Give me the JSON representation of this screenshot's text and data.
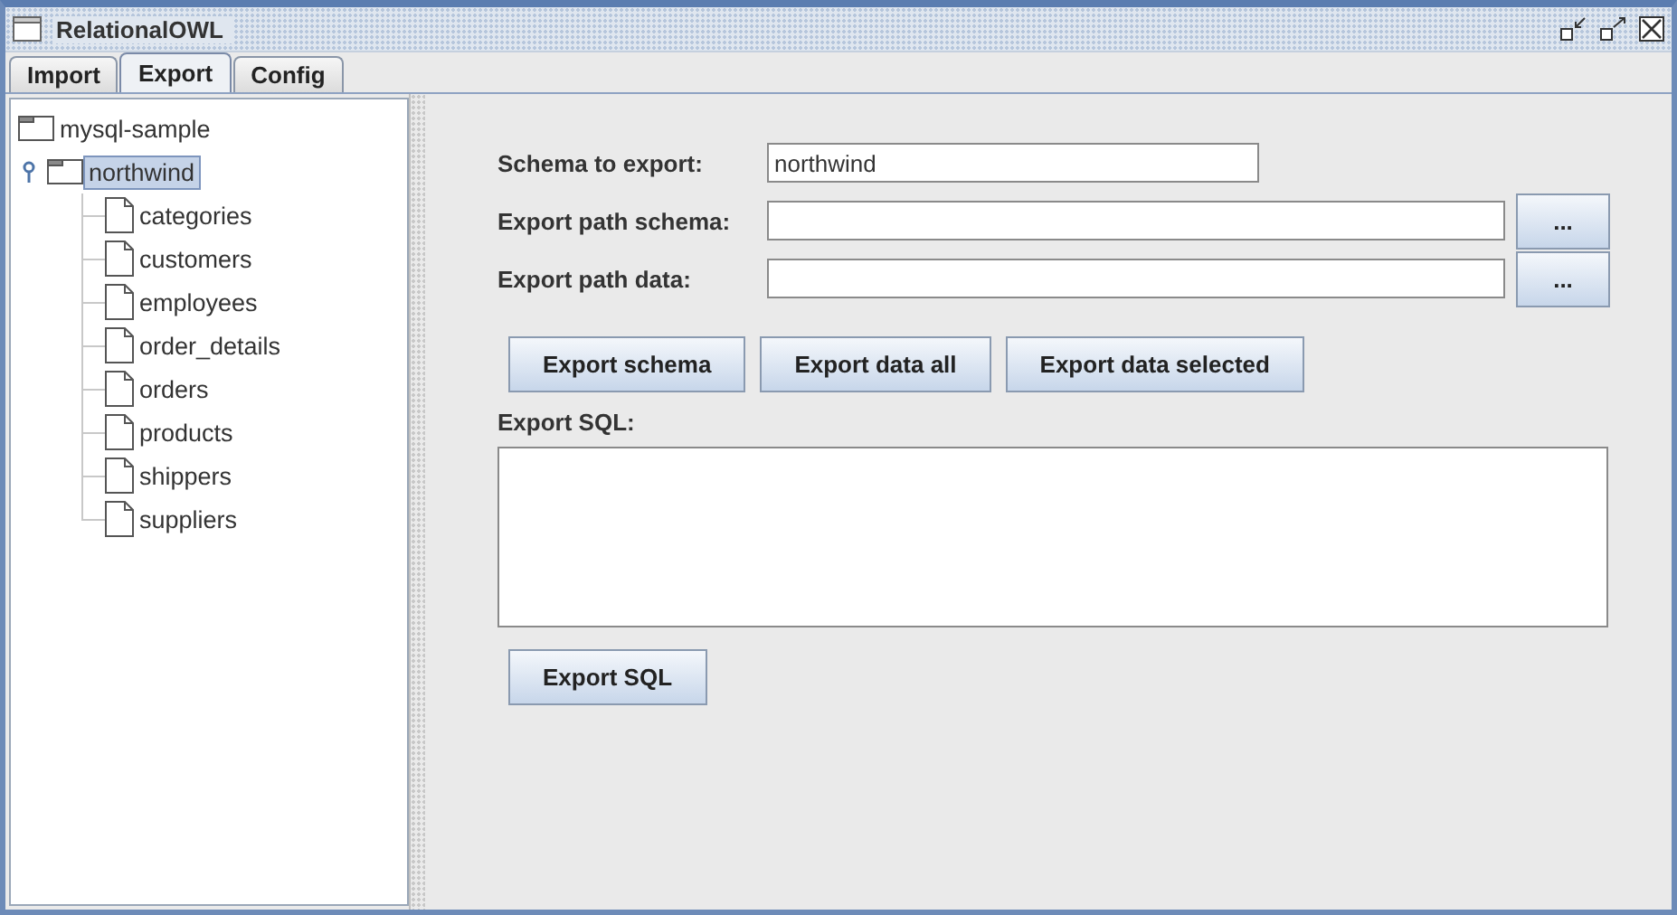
{
  "window": {
    "title": "RelationalOWL"
  },
  "tabs": [
    {
      "label": "Import",
      "selected": false
    },
    {
      "label": "Export",
      "selected": true
    },
    {
      "label": "Config",
      "selected": false
    }
  ],
  "tree": {
    "label": "mysql-sample",
    "kind": "folder",
    "selected": false,
    "children": [
      {
        "label": "northwind",
        "kind": "folder",
        "selected": true,
        "children": [
          {
            "label": "categories",
            "kind": "table",
            "selected": false
          },
          {
            "label": "customers",
            "kind": "table",
            "selected": false
          },
          {
            "label": "employees",
            "kind": "table",
            "selected": false
          },
          {
            "label": "order_details",
            "kind": "table",
            "selected": false
          },
          {
            "label": "orders",
            "kind": "table",
            "selected": false
          },
          {
            "label": "products",
            "kind": "table",
            "selected": false
          },
          {
            "label": "shippers",
            "kind": "table",
            "selected": false
          },
          {
            "label": "suppliers",
            "kind": "table",
            "selected": false
          }
        ]
      }
    ]
  },
  "fields": [
    {
      "label": "Schema to export:",
      "value": "northwind"
    },
    {
      "label": "Export path schema:",
      "browse_button": "..."
    },
    {
      "label": "Export path data:",
      "browse_button": "..."
    }
  ],
  "actions": [
    "Export schema",
    "Export data all",
    "Export data selected"
  ],
  "sql": {
    "label": "Export SQL:",
    "button": "Export SQL"
  }
}
